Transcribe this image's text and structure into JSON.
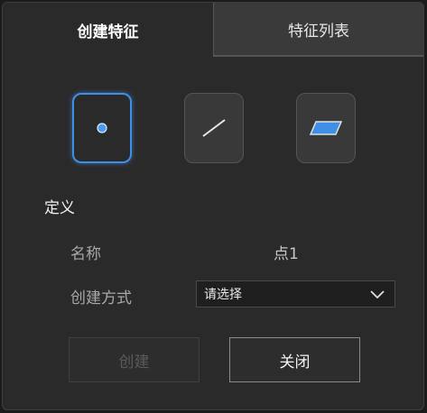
{
  "tabs": {
    "create_feature": "创建特征",
    "feature_list": "特征列表"
  },
  "feature_types": [
    {
      "icon": "point-icon",
      "selected": true
    },
    {
      "icon": "line-icon",
      "selected": false
    },
    {
      "icon": "plane-icon",
      "selected": false
    }
  ],
  "definition": {
    "title": "定义",
    "name_label": "名称",
    "name_value": "点1",
    "method_label": "创建方式",
    "method_select_value": "请选择"
  },
  "buttons": {
    "create": "创建",
    "close": "关闭"
  },
  "colors": {
    "accent": "#3f8fe6",
    "panel_bg": "#2b2a2a"
  }
}
